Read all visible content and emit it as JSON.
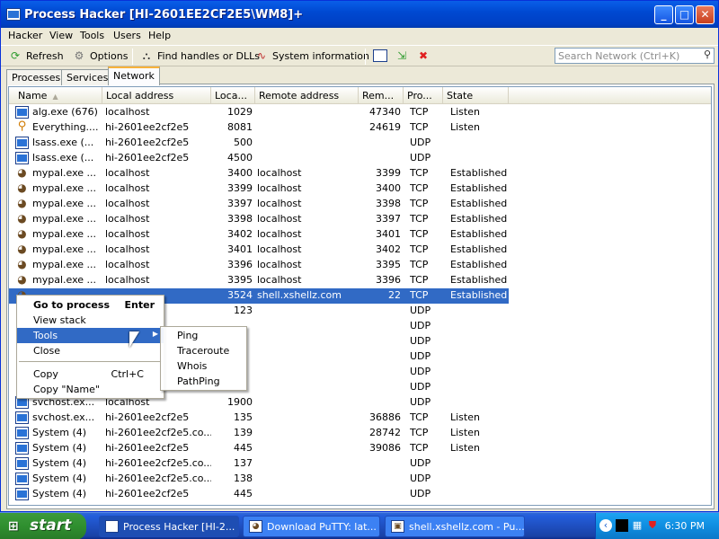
{
  "window": {
    "title": "Process Hacker [HI-2601EE2CF2E5\\WM8]+",
    "buttons": [
      "_",
      "□",
      "✕"
    ]
  },
  "menubar": [
    "Hacker",
    "View",
    "Tools",
    "Users",
    "Help"
  ],
  "toolbar": {
    "refresh": "Refresh",
    "options": "Options",
    "find_handles": "Find handles or DLLs",
    "system_information": "System information",
    "search_placeholder": "Search Network (Ctrl+K)"
  },
  "tabs": [
    "Processes",
    "Services",
    "Network"
  ],
  "columns": [
    "Name",
    "Local address",
    "Loca...",
    "Remote address",
    "Rem...",
    "Pro...",
    "State"
  ],
  "rows": [
    {
      "icon": "window-icon",
      "name": "alg.exe (676)",
      "local": "localhost",
      "lport": "1029",
      "remote": "",
      "rport": "47340",
      "proto": "TCP",
      "state": "Listen"
    },
    {
      "icon": "magnifier-icon",
      "name": "Everything....",
      "local": "hi-2601ee2cf2e5",
      "lport": "8081",
      "remote": "",
      "rport": "24619",
      "proto": "TCP",
      "state": "Listen"
    },
    {
      "icon": "window-icon",
      "name": "lsass.exe (...",
      "local": "hi-2601ee2cf2e5",
      "lport": "500",
      "remote": "",
      "rport": "",
      "proto": "UDP",
      "state": ""
    },
    {
      "icon": "window-icon",
      "name": "lsass.exe (...",
      "local": "hi-2601ee2cf2e5",
      "lport": "4500",
      "remote": "",
      "rport": "",
      "proto": "UDP",
      "state": ""
    },
    {
      "icon": "fox-icon",
      "name": "mypal.exe ...",
      "local": "localhost",
      "lport": "3400",
      "remote": "localhost",
      "rport": "3399",
      "proto": "TCP",
      "state": "Established"
    },
    {
      "icon": "fox-icon",
      "name": "mypal.exe ...",
      "local": "localhost",
      "lport": "3399",
      "remote": "localhost",
      "rport": "3400",
      "proto": "TCP",
      "state": "Established"
    },
    {
      "icon": "fox-icon",
      "name": "mypal.exe ...",
      "local": "localhost",
      "lport": "3397",
      "remote": "localhost",
      "rport": "3398",
      "proto": "TCP",
      "state": "Established"
    },
    {
      "icon": "fox-icon",
      "name": "mypal.exe ...",
      "local": "localhost",
      "lport": "3398",
      "remote": "localhost",
      "rport": "3397",
      "proto": "TCP",
      "state": "Established"
    },
    {
      "icon": "fox-icon",
      "name": "mypal.exe ...",
      "local": "localhost",
      "lport": "3402",
      "remote": "localhost",
      "rport": "3401",
      "proto": "TCP",
      "state": "Established"
    },
    {
      "icon": "fox-icon",
      "name": "mypal.exe ...",
      "local": "localhost",
      "lport": "3401",
      "remote": "localhost",
      "rport": "3402",
      "proto": "TCP",
      "state": "Established"
    },
    {
      "icon": "fox-icon",
      "name": "mypal.exe ...",
      "local": "localhost",
      "lport": "3396",
      "remote": "localhost",
      "rport": "3395",
      "proto": "TCP",
      "state": "Established"
    },
    {
      "icon": "fox-icon",
      "name": "mypal.exe ...",
      "local": "localhost",
      "lport": "3395",
      "remote": "localhost",
      "rport": "3396",
      "proto": "TCP",
      "state": "Established"
    },
    {
      "icon": "fox-icon",
      "name": "",
      "local": "",
      "lport": "3524",
      "remote": "shell.xshellz.com",
      "rport": "22",
      "proto": "TCP",
      "state": "Established",
      "selected": true
    },
    {
      "icon": "",
      "name": "",
      "local": "",
      "lport": "123",
      "remote": "",
      "rport": "",
      "proto": "UDP",
      "state": ""
    },
    {
      "icon": "",
      "name": "",
      "local": "",
      "lport": "",
      "remote": "",
      "rport": "",
      "proto": "UDP",
      "state": ""
    },
    {
      "icon": "",
      "name": "",
      "local": "",
      "lport": "",
      "remote": "",
      "rport": "",
      "proto": "UDP",
      "state": ""
    },
    {
      "icon": "",
      "name": "",
      "local": "",
      "lport": "",
      "remote": "",
      "rport": "",
      "proto": "UDP",
      "state": ""
    },
    {
      "icon": "",
      "name": "",
      "local": "",
      "lport": "",
      "remote": "",
      "rport": "",
      "proto": "UDP",
      "state": ""
    },
    {
      "icon": "",
      "name": "",
      "local": "",
      "lport": "",
      "remote": "",
      "rport": "",
      "proto": "UDP",
      "state": ""
    },
    {
      "icon": "window-icon",
      "name": "svchost.ex...",
      "local": "localhost",
      "lport": "1900",
      "remote": "",
      "rport": "",
      "proto": "UDP",
      "state": ""
    },
    {
      "icon": "window-icon",
      "name": "svchost.ex...",
      "local": "hi-2601ee2cf2e5",
      "lport": "135",
      "remote": "",
      "rport": "36886",
      "proto": "TCP",
      "state": "Listen"
    },
    {
      "icon": "window-icon",
      "name": "System (4)",
      "local": "hi-2601ee2cf2e5.co...",
      "lport": "139",
      "remote": "",
      "rport": "28742",
      "proto": "TCP",
      "state": "Listen"
    },
    {
      "icon": "window-icon",
      "name": "System (4)",
      "local": "hi-2601ee2cf2e5",
      "lport": "445",
      "remote": "",
      "rport": "39086",
      "proto": "TCP",
      "state": "Listen"
    },
    {
      "icon": "window-icon",
      "name": "System (4)",
      "local": "hi-2601ee2cf2e5.co...",
      "lport": "137",
      "remote": "",
      "rport": "",
      "proto": "UDP",
      "state": ""
    },
    {
      "icon": "window-icon",
      "name": "System (4)",
      "local": "hi-2601ee2cf2e5.co...",
      "lport": "138",
      "remote": "",
      "rport": "",
      "proto": "UDP",
      "state": ""
    },
    {
      "icon": "window-icon",
      "name": "System (4)",
      "local": "hi-2601ee2cf2e5",
      "lport": "445",
      "remote": "",
      "rport": "",
      "proto": "UDP",
      "state": ""
    }
  ],
  "context_menu": {
    "go_to_process": "Go to process",
    "go_to_process_shortcut": "Enter",
    "view_stack": "View stack",
    "tools": "Tools",
    "close": "Close",
    "copy": "Copy",
    "copy_shortcut": "Ctrl+C",
    "copy_name": "Copy \"Name\""
  },
  "tools_submenu": [
    "Ping",
    "Traceroute",
    "Whois",
    "PathPing"
  ],
  "taskbar": {
    "start": "start",
    "tasks": [
      "Process Hacker [HI-2...",
      "Download PuTTY: lat...",
      "shell.xshellz.com - Pu..."
    ],
    "clock": "6:30 PM"
  }
}
